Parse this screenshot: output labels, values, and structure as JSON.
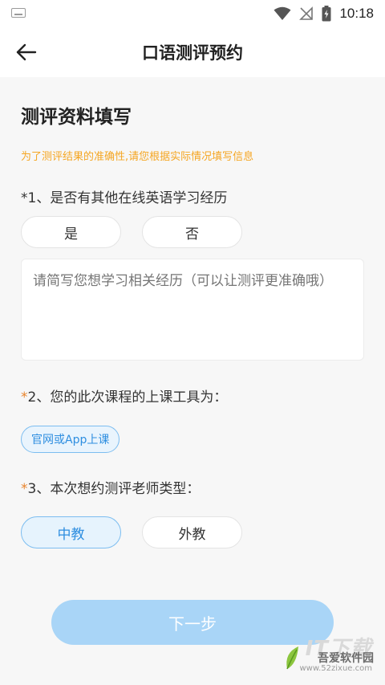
{
  "status_bar": {
    "time": "10:18"
  },
  "header": {
    "title": "口语测评预约"
  },
  "form": {
    "section_title": "测评资料填写",
    "hint": "为了测评结果的准确性,请您根据实际情况填写信息",
    "q1": {
      "prefix": "*1、",
      "text": "是否有其他在线英语学习经历",
      "options": [
        "是",
        "否"
      ]
    },
    "experience_placeholder": "请简写您想学习相关经历（可以让测评更准确哦）",
    "q2": {
      "star": "*",
      "text": "2、您的此次课程的上课工具为：",
      "tool": "官网或App上课"
    },
    "q3": {
      "star": "*",
      "text": "3、本次想约测评老师类型：",
      "options": [
        "中教",
        "外教"
      ],
      "selected": "中教"
    },
    "next_label": "下一步"
  },
  "watermark": {
    "logo": "IT下载",
    "name": "吾爱软件园",
    "url": "www.52zixue.com"
  },
  "colors": {
    "accent": "#2e8ee0",
    "hint": "#f5a623",
    "star": "#e8842d",
    "button_disabled": "#a9d5f7"
  }
}
